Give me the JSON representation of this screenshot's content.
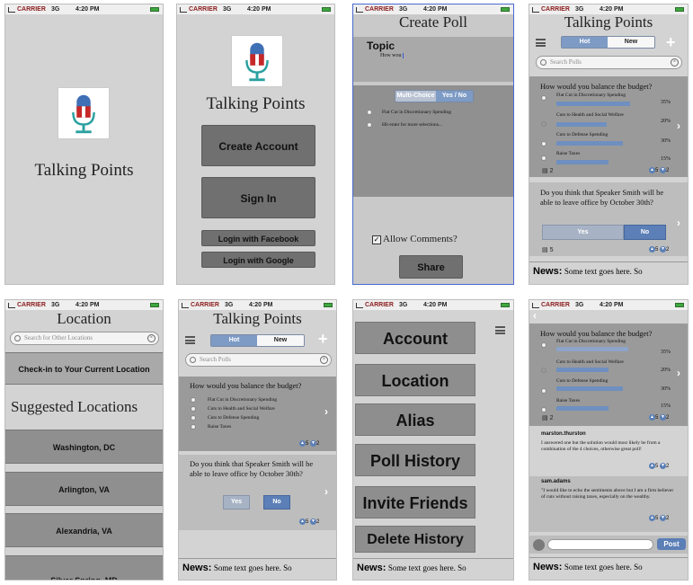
{
  "status_bar": {
    "carrier": "CARRIER",
    "network": "3G",
    "time": "4:20 PM"
  },
  "app_name": "Talking Points",
  "create_poll": {
    "title": "Create Poll",
    "topic_label": "Topic",
    "topic_value": "How wou",
    "type_tabs": [
      "Multi-Choice",
      "Yes / No"
    ],
    "options": [
      "Flat Cut in Discretionary Spending",
      "Hit enter for more selections..."
    ],
    "allow_comments": "Allow Comments?",
    "share": "Share"
  },
  "welcome": {
    "create_account": "Create Account",
    "sign_in": "Sign In",
    "login_facebook": "Login with Facebook",
    "login_google": "Login with Google"
  },
  "feed": {
    "tabs": [
      "Hot",
      "New"
    ],
    "search_placeholder": "Search Polls",
    "poll1": {
      "question": "How would you balance the budget?",
      "options": [
        "Flat Cut in Discretionary Spending",
        "Cuts to Health and Social Welfare",
        "Cuts to Defense Spending",
        "Raise Taxes"
      ],
      "percents": [
        "35%",
        "20%",
        "30%",
        "15%"
      ],
      "percent_values": [
        35,
        20,
        30,
        15
      ],
      "comments": "2",
      "up": "5",
      "down": "2"
    },
    "poll2": {
      "question": "Do you think that Speaker Smith will be able to leave office by October 30th?",
      "yes": "Yes",
      "no": "No",
      "comments": "5",
      "up": "5",
      "down": "2"
    },
    "news_label": "News:",
    "news_text": "Some text goes here. So"
  },
  "location": {
    "title": "Location",
    "search_placeholder": "Search for Other Locations",
    "check_in": "Check-in to Your Current Location",
    "suggested": "Suggested Locations",
    "items": [
      "Washington, DC",
      "Arlington, VA",
      "Alexandria, VA",
      "Silver Spring, MD"
    ]
  },
  "menu": {
    "items": [
      "Account",
      "Location",
      "Alias",
      "Poll History",
      "Invite Friends",
      "Delete History"
    ]
  },
  "comments": {
    "items": [
      {
        "user": "marston.thurston",
        "text": "I answered one but the solution would most likely be from a combination of the 4 choices, otherwise great poll!",
        "up": "5",
        "down": "2"
      },
      {
        "user": "sam.adams",
        "text": "\"I would like to echo the sentiments above but I am a firm believer of cuts without raising taxes, especially on the wealthy.",
        "up": "5",
        "down": "2"
      }
    ],
    "post": "Post"
  }
}
